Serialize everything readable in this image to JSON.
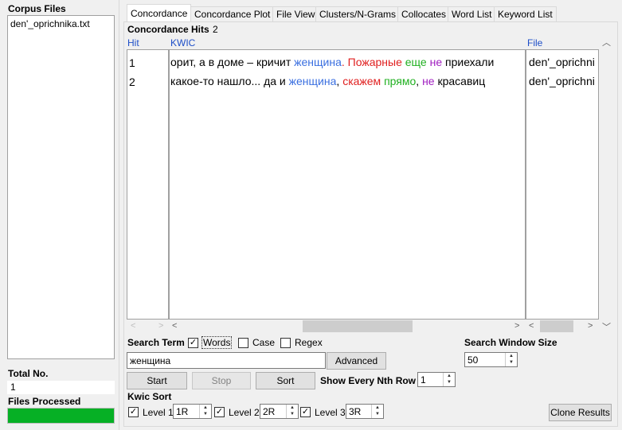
{
  "left_panel": {
    "corpus_files_title": "Corpus Files",
    "files": [
      "den'_oprichnika.txt"
    ],
    "total_no_label": "Total No.",
    "total_no_value": "1",
    "files_processed_label": "Files Processed",
    "progress": 1.0
  },
  "tabs": [
    {
      "label": "Concordance",
      "active": true
    },
    {
      "label": "Concordance Plot"
    },
    {
      "label": "File View"
    },
    {
      "label": "Clusters/N-Grams"
    },
    {
      "label": "Collocates"
    },
    {
      "label": "Word List"
    },
    {
      "label": "Keyword List"
    }
  ],
  "hits": {
    "label": "Concordance Hits",
    "count": "2"
  },
  "columns": {
    "hit": "Hit",
    "kwic": "KWIC",
    "file": "File"
  },
  "rows": [
    {
      "hit": "1",
      "left": "орит, а в доме – кричит",
      "node": "женщина",
      "right_parts": [
        ". ",
        "Пожарные",
        " ",
        "еще",
        " ",
        "не",
        " приехали"
      ],
      "file": "den'_oprichni"
    },
    {
      "hit": "2",
      "left": " какое-то нашло... да и",
      "node": "женщина",
      "right_parts": [
        ", ",
        "скажем",
        " ",
        "прямо",
        ", ",
        "не",
        " красавиц"
      ],
      "file": "den'_oprichni"
    }
  ],
  "search": {
    "term_label": "Search Term",
    "words_label": "Words",
    "words_checked": true,
    "case_label": "Case",
    "case_checked": false,
    "regex_label": "Regex",
    "regex_checked": false,
    "query": "женщина",
    "advanced_label": "Advanced",
    "window_size_label": "Search Window Size",
    "window_size": "50"
  },
  "actions": {
    "start": "Start",
    "stop": "Stop",
    "sort": "Sort",
    "nth_row_label": "Show Every Nth Row",
    "nth_row_value": "1",
    "clone": "Clone Results"
  },
  "kwic_sort": {
    "label": "Kwic Sort",
    "levels": [
      {
        "label": "Level 1",
        "value": "1R",
        "checked": true
      },
      {
        "label": "Level 2",
        "value": "2R",
        "checked": true
      },
      {
        "label": "Level 3",
        "value": "3R",
        "checked": true
      }
    ]
  },
  "colors": {
    "node": "#3a6fe0",
    "sort1": "#e02020",
    "sort2": "#20b020",
    "sort3": "#a020c0",
    "progress": "#06b025"
  }
}
